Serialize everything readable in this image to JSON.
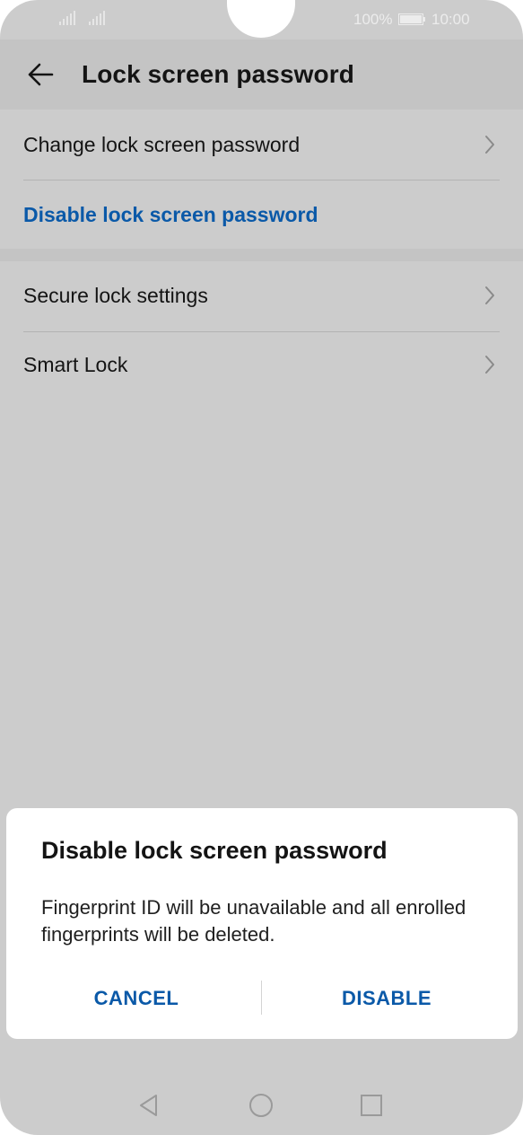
{
  "status_bar": {
    "battery_percent": "100%",
    "time": "10:00",
    "icons": [
      "signal-icon",
      "signal-icon",
      "battery-icon"
    ]
  },
  "app_bar": {
    "title": "Lock screen password",
    "back_icon": "arrow-left-icon"
  },
  "settings": {
    "group1": [
      {
        "label": "Change lock screen password",
        "has_chevron": true
      },
      {
        "label": "Disable lock screen password",
        "has_chevron": false,
        "accent": true
      }
    ],
    "group2": [
      {
        "label": "Secure lock settings",
        "has_chevron": true
      },
      {
        "label": "Smart Lock",
        "has_chevron": true
      }
    ]
  },
  "dialog": {
    "title": "Disable lock screen password",
    "message": "Fingerprint ID will be unavailable and all enrolled fingerprints will be deleted.",
    "cancel_label": "CANCEL",
    "confirm_label": "DISABLE"
  },
  "nav_bar": {
    "icons": [
      "triangle-back-icon",
      "circle-home-icon",
      "square-recents-icon"
    ]
  },
  "colors": {
    "accent": "#0a59a8",
    "scrim_background": "#cccccc",
    "dialog_background": "#ffffff"
  }
}
